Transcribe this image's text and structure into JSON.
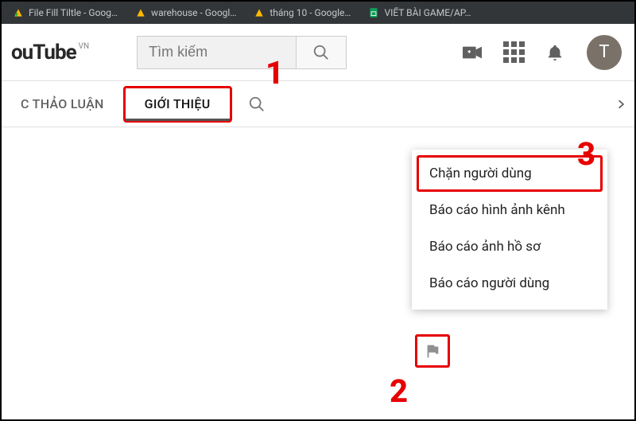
{
  "browser_tabs": [
    {
      "label": "File Fill Tiltle - Goog…",
      "icon": "drive"
    },
    {
      "label": "warehouse - Googl…",
      "icon": "drive"
    },
    {
      "label": "tháng 10 - Google…",
      "icon": "drive"
    },
    {
      "label": "VIẾT BÀI GAME/AP…",
      "icon": "sheets"
    }
  ],
  "logo": {
    "text": "ouTube",
    "region": "VN"
  },
  "search": {
    "placeholder": "Tìm kiếm"
  },
  "avatar_initial": "T",
  "channel_tabs": {
    "discussion": "C THẢO LUẬN",
    "about": "GIỚI THIỆU"
  },
  "dropdown": {
    "block_user": "Chặn người dùng",
    "report_channel_art": "Báo cáo hình ảnh kênh",
    "report_profile_pic": "Báo cáo ảnh hồ sơ",
    "report_user": "Báo cáo người dùng"
  },
  "annotations": {
    "a1": "1",
    "a2": "2",
    "a3": "3"
  }
}
